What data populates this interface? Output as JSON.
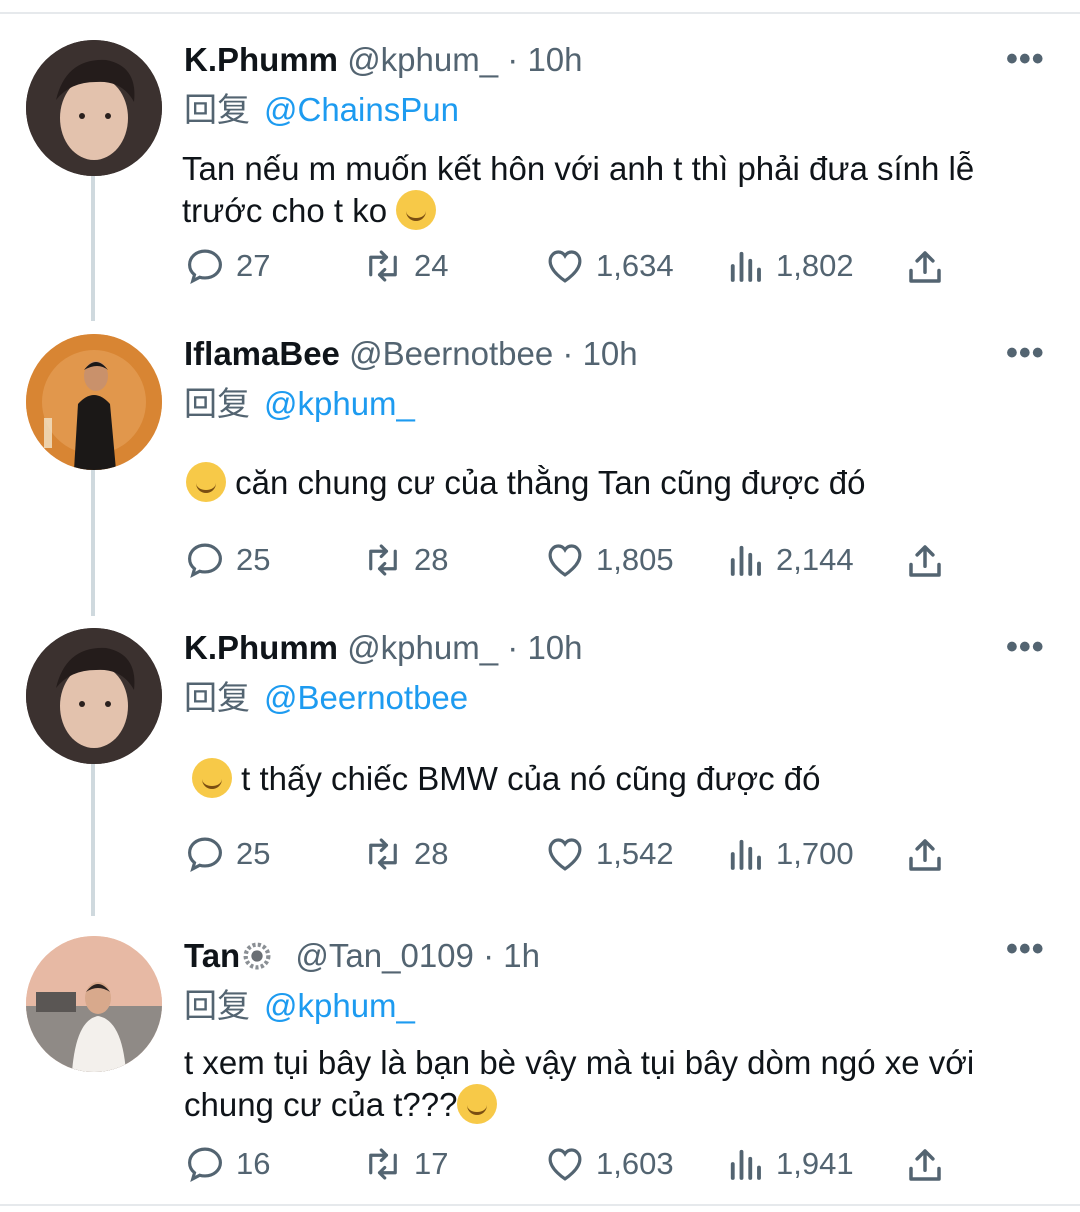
{
  "reply_label": "回复",
  "tweets": [
    {
      "name": "K.Phumm",
      "handle": "@kphum_",
      "dot": "·",
      "time": "10h",
      "reply_to": "@ChainsPun",
      "text": "Tan nếu m muốn kết hôn với anh t thì phải đưa sính lễ trước cho t ko",
      "emoji": "thinking-face",
      "replies": "27",
      "retweets": "24",
      "likes": "1,634",
      "views": "1,802"
    },
    {
      "name": "IflamaBee",
      "handle": "@Beernotbee",
      "dot": "·",
      "time": "10h",
      "reply_to": "@kphum_",
      "text": "căn chung cư của thằng Tan cũng được đó",
      "emoji": "rolling-on-floor-laughing",
      "replies": "25",
      "retweets": "28",
      "likes": "1,805",
      "views": "2,144"
    },
    {
      "name": "K.Phumm",
      "handle": "@kphum_",
      "dot": "·",
      "time": "10h",
      "reply_to": "@Beernotbee",
      "text": "t thấy chiếc BMW của nó cũng được đó",
      "emoji": "smirking-face",
      "replies": "25",
      "retweets": "28",
      "likes": "1,542",
      "views": "1,700"
    },
    {
      "name": "Tan",
      "handle": "@Tan_0109",
      "dot": "·",
      "time": "1h",
      "reply_to": "@kphum_",
      "text": "t xem tụi bây là bạn bè vậy mà tụi bây dòm ngó xe với chung cư của t???",
      "emoji": "slightly-smiling-face",
      "replies": "16",
      "retweets": "17",
      "likes": "1,603",
      "views": "1,941"
    }
  ]
}
